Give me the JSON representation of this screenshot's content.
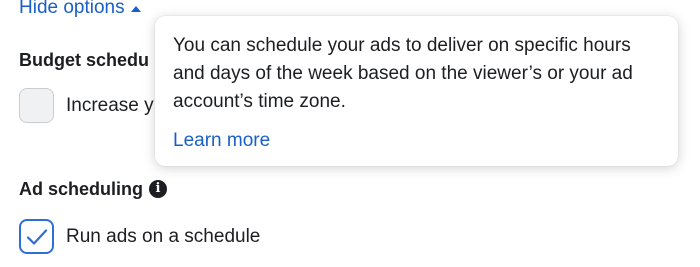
{
  "toggle": {
    "label": "Hide options",
    "icon": "caret-up-icon"
  },
  "budget_scheduling": {
    "title_visible": "Budget schedu",
    "checkbox_label_visible": "Increase y",
    "checked": false
  },
  "tooltip": {
    "text": "You can schedule your ads to deliver on specific hours and days of the week based on the viewer’s or your ad account’s time zone.",
    "link": "Learn more"
  },
  "ad_scheduling": {
    "title": "Ad scheduling",
    "info_icon": "info-icon",
    "checkbox_label": "Run ads on a schedule",
    "checked": true
  },
  "colors": {
    "link": "#1a5fc9",
    "checkbox_border_checked": "#2d6fd6",
    "text": "#1c1e21"
  }
}
